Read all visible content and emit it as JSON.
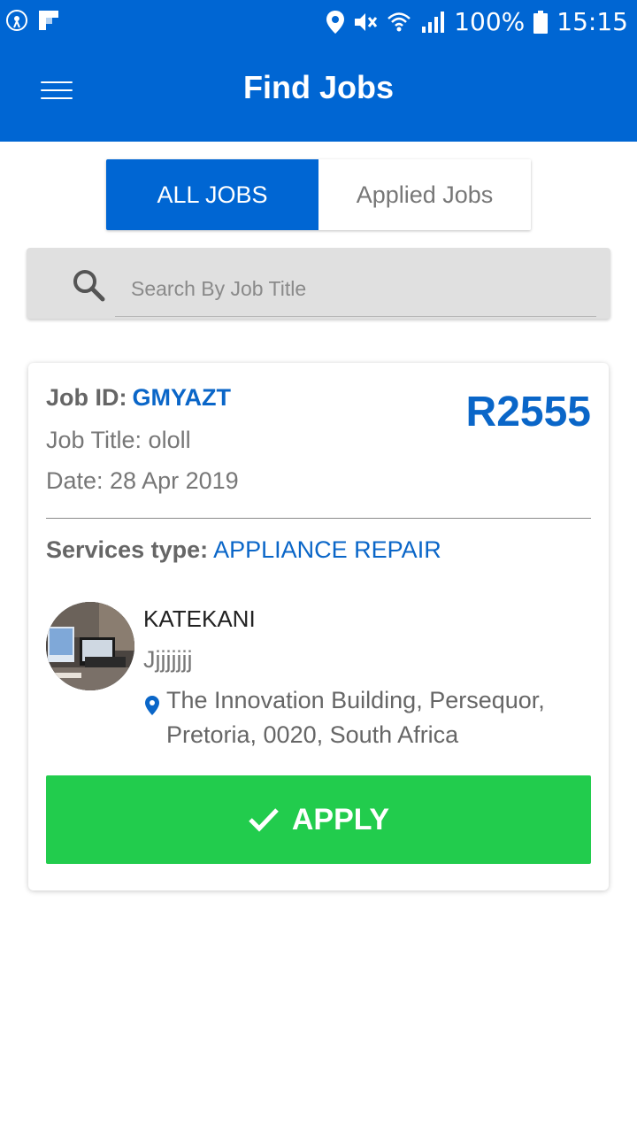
{
  "status_bar": {
    "battery": "100%",
    "time": "15:15",
    "icons": [
      "radio-icon",
      "flipboard-icon",
      "location-icon",
      "mute-icon",
      "wifi-icon",
      "signal-icon",
      "battery-icon"
    ]
  },
  "header": {
    "title": "Find Jobs",
    "menu_icon": "hamburger-menu-icon"
  },
  "tabs": [
    {
      "label": "ALL JOBS",
      "active": true
    },
    {
      "label": "Applied Jobs",
      "active": false
    }
  ],
  "search": {
    "placeholder": "Search By Job Title",
    "value": ""
  },
  "job": {
    "id_label": "Job ID:",
    "id": "GMYAZT",
    "title_line": "Job Title: ololl",
    "date_line": "Date: 28 Apr 2019",
    "price": "R2555",
    "services_label": "Services type:",
    "services_value": "APPLIANCE REPAIR",
    "client_name": "KATEKANI",
    "description": "Jjjjjjjj",
    "address": "The Innovation Building, Persequor, Pretoria, 0020, South Africa",
    "apply_label": "APPLY"
  },
  "colors": {
    "primary": "#0066d3",
    "accent_text": "#0a66c8",
    "apply": "#22cc4d"
  }
}
